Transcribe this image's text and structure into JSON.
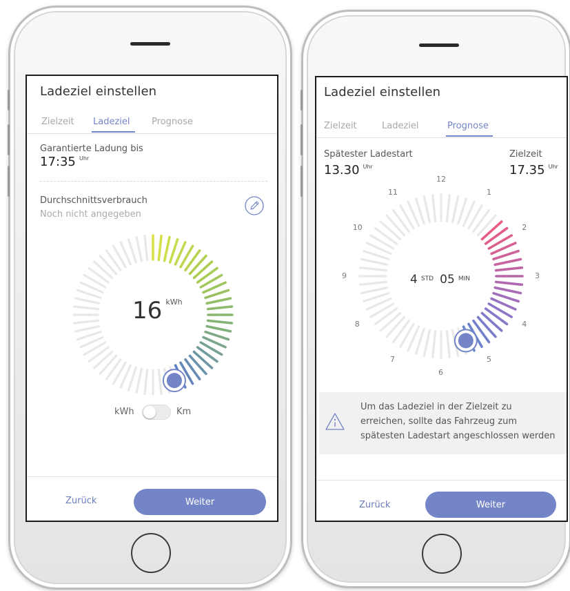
{
  "left_screen": {
    "title": "Ladeziel einstellen",
    "tabs": [
      {
        "label": "Zielzeit",
        "active": false
      },
      {
        "label": "Ladeziel",
        "active": true
      },
      {
        "label": "Prognose",
        "active": false
      }
    ],
    "guarantee_label": "Garantierte Ladung bis",
    "guarantee_time": "17:35",
    "guarantee_unit": "Uhr",
    "consumption_label": "Durchschnittsverbrauch",
    "consumption_value": "Noch nicht angegeben",
    "edit_icon": "pencil-icon",
    "dial": {
      "value": "16",
      "unit": "kWh",
      "fill_fraction": 0.45
    },
    "toggle": {
      "left_label": "kWh",
      "right_label": "Km",
      "state": "kWh"
    },
    "back_label": "Zurück",
    "next_label": "Weiter"
  },
  "right_screen": {
    "title": "Ladeziel einstellen",
    "tabs": [
      {
        "label": "Zielzeit",
        "active": false
      },
      {
        "label": "Ladeziel",
        "active": false
      },
      {
        "label": "Prognose",
        "active": true
      }
    ],
    "latest_start_label": "Spätester Ladestart",
    "latest_start_time": "13.30",
    "latest_start_unit": "Uhr",
    "target_label": "Zielzeit",
    "target_time": "17.35",
    "target_unit": "Uhr",
    "clock_hours": [
      "12",
      "1",
      "2",
      "3",
      "4",
      "5",
      "6",
      "7",
      "8",
      "9",
      "10",
      "11"
    ],
    "duration": {
      "hours": "4",
      "hours_unit": "STD",
      "minutes": "05",
      "minutes_unit": "MIN"
    },
    "info_icon": "warning-triangle-icon",
    "info_lines": [
      "Um das Ladeziel in der Zielzeit zu",
      "erreichen, sollte das Fahrzeug zum",
      "spätesten Ladestart angeschlossen werden"
    ],
    "back_label": "Zurück",
    "next_label": "Weiter"
  },
  "colors": {
    "accent": "#7385c6",
    "tick_inactive": "#e8e8e8",
    "left_gradient": [
      "#d9e24a",
      "#a9cc52",
      "#7fae7e",
      "#5f80c4"
    ],
    "right_gradient": [
      "#e85b82",
      "#c064a4",
      "#8e74c8",
      "#6686c9"
    ]
  }
}
